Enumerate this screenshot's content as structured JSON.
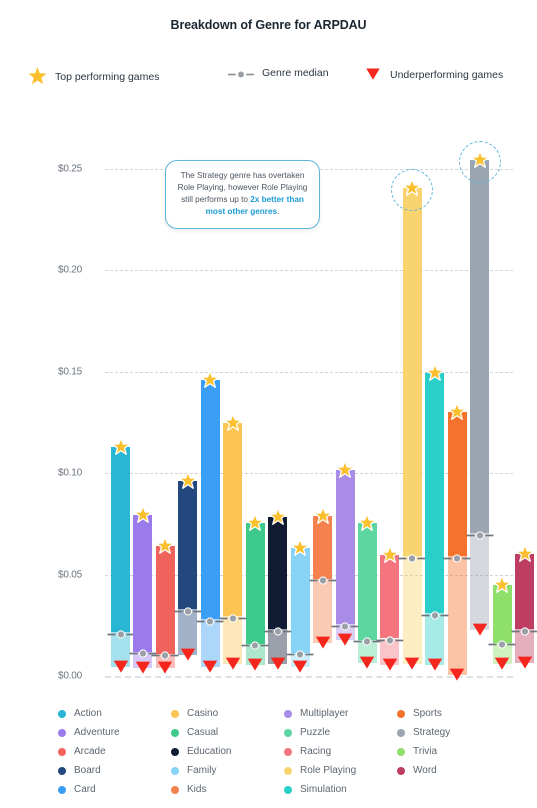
{
  "header": {
    "title": "Breakdown of Genre for ARPDAU"
  },
  "top_legend": [
    {
      "icon": "star-icon",
      "label": "Top performing games",
      "color": "#FBC02D"
    },
    {
      "icon": "median-line-icon",
      "label": "Genre median",
      "color": "#8A8F96"
    },
    {
      "icon": "down-triangle-icon",
      "label": "Underperforming games",
      "color": "#F4261D"
    }
  ],
  "annotation": {
    "text_before": "The Strategy genre has overtaken Role Playing, however Role Playing still performs up to ",
    "highlight": "2x better than most other genres",
    "text_after": "."
  },
  "chart_data": {
    "type": "bar",
    "title": "Breakdown of Genre for ARPDAU",
    "xlabel": "",
    "ylabel": "",
    "ylim": [
      0,
      0.25
    ],
    "ytick_labels": [
      "$0.00",
      "$0.05",
      "$0.10",
      "$0.15",
      "$0.20",
      "$0.25"
    ],
    "ytick_values": [
      0,
      0.05,
      0.1,
      0.15,
      0.2,
      0.25
    ],
    "grid": true,
    "legend_position": "bottom",
    "series": [
      {
        "name": "Top performing games",
        "marker": "star"
      },
      {
        "name": "Genre median",
        "marker": "circle"
      },
      {
        "name": "Underperforming games",
        "marker": "triangle"
      }
    ],
    "categories": [
      "Action",
      "Adventure",
      "Arcade",
      "Board",
      "Card",
      "Casino",
      "Casual",
      "Education",
      "Family",
      "Kids",
      "Multiplayer",
      "Puzzle",
      "Racing",
      "Role Playing",
      "Simulation",
      "Sports",
      "Strategy",
      "Trivia",
      "Word"
    ],
    "top": [
      0.113,
      0.0795,
      0.064,
      0.096,
      0.146,
      0.125,
      0.0755,
      0.0785,
      0.063,
      0.079,
      0.1015,
      0.0755,
      0.0595,
      0.2405,
      0.1495,
      0.13,
      0.2545,
      0.045,
      0.06
    ],
    "median": [
      0.0215,
      0.012,
      0.011,
      0.033,
      0.028,
      0.0295,
      0.016,
      0.023,
      0.0115,
      0.048,
      0.0255,
      0.018,
      0.0185,
      0.059,
      0.031,
      0.059,
      0.0705,
      0.0165,
      0.023
    ],
    "bottom": [
      0.0045,
      0.004,
      0.004,
      0.0105,
      0.0045,
      0.006,
      0.0055,
      0.006,
      0.0045,
      0.0165,
      0.018,
      0.0065,
      0.0055,
      0.006,
      0.0055,
      0.0005,
      0.0225,
      0.006,
      0.0065
    ],
    "colors": [
      "#29B5D4",
      "#9B7BEC",
      "#F0635C",
      "#22487D",
      "#3B9EF5",
      "#FBC453",
      "#3CC98A",
      "#111B33",
      "#87D3F5",
      "#F4814E",
      "#A98BE8",
      "#5DD6A0",
      "#F4757E",
      "#F8D370",
      "#2BCFC9",
      "#F5722C",
      "#9AA5B1",
      "#8FE06A",
      "#BE3D62"
    ],
    "highlighted": [
      "Role Playing",
      "Strategy"
    ]
  },
  "genre_legend": {
    "columns": [
      [
        {
          "label": "Action",
          "color": "#29B5D4"
        },
        {
          "label": "Adventure",
          "color": "#9B7BEC"
        },
        {
          "label": "Arcade",
          "color": "#F0635C"
        },
        {
          "label": "Board",
          "color": "#22487D"
        },
        {
          "label": "Card",
          "color": "#3B9EF5"
        }
      ],
      [
        {
          "label": "Casino",
          "color": "#FBC453"
        },
        {
          "label": "Casual",
          "color": "#3CC98A"
        },
        {
          "label": "Education",
          "color": "#111B33"
        },
        {
          "label": "Family",
          "color": "#87D3F5"
        },
        {
          "label": "Kids",
          "color": "#F4814E"
        }
      ],
      [
        {
          "label": "Multiplayer",
          "color": "#A98BE8"
        },
        {
          "label": "Puzzle",
          "color": "#5DD6A0"
        },
        {
          "label": "Racing",
          "color": "#F4757E"
        },
        {
          "label": "Role Playing",
          "color": "#F8D370"
        },
        {
          "label": "Simulation",
          "color": "#2BCFC9"
        }
      ],
      [
        {
          "label": "Sports",
          "color": "#F5722C"
        },
        {
          "label": "Strategy",
          "color": "#9AA5B1"
        },
        {
          "label": "Trivia",
          "color": "#8FE06A"
        },
        {
          "label": "Word",
          "color": "#BE3D62"
        }
      ]
    ]
  }
}
